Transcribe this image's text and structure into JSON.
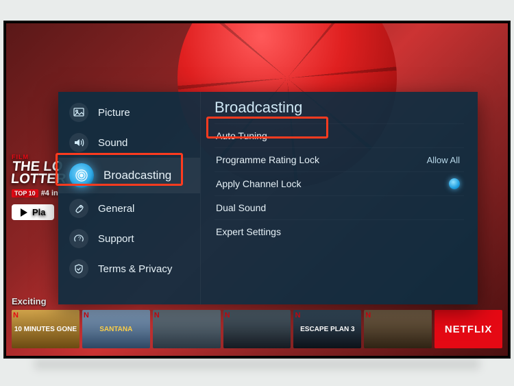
{
  "background": {
    "film_label": "FILM",
    "title_line1": "THE LO",
    "title_line2": "LOTTER",
    "top10_badge": "TOP 10",
    "rank_text": "#4 in",
    "play_label": "Pla",
    "category_label": "Exciting",
    "thumbs": [
      "10 MINUTES GONE",
      "SANTANA",
      "",
      "",
      "ESCAPE PLAN 3",
      "",
      "NETFLIX"
    ]
  },
  "settings": {
    "sidebar": {
      "items": [
        {
          "label": "Picture"
        },
        {
          "label": "Sound"
        },
        {
          "label": "Broadcasting",
          "selected": true
        },
        {
          "label": "General"
        },
        {
          "label": "Support"
        },
        {
          "label": "Terms & Privacy"
        }
      ]
    },
    "panel": {
      "title": "Broadcasting",
      "options": [
        {
          "label": "Auto Tuning"
        },
        {
          "label": "Programme Rating Lock",
          "value": "Allow All"
        },
        {
          "label": "Apply Channel Lock",
          "toggle": true
        },
        {
          "label": "Dual Sound"
        },
        {
          "label": "Expert Settings"
        }
      ]
    }
  }
}
